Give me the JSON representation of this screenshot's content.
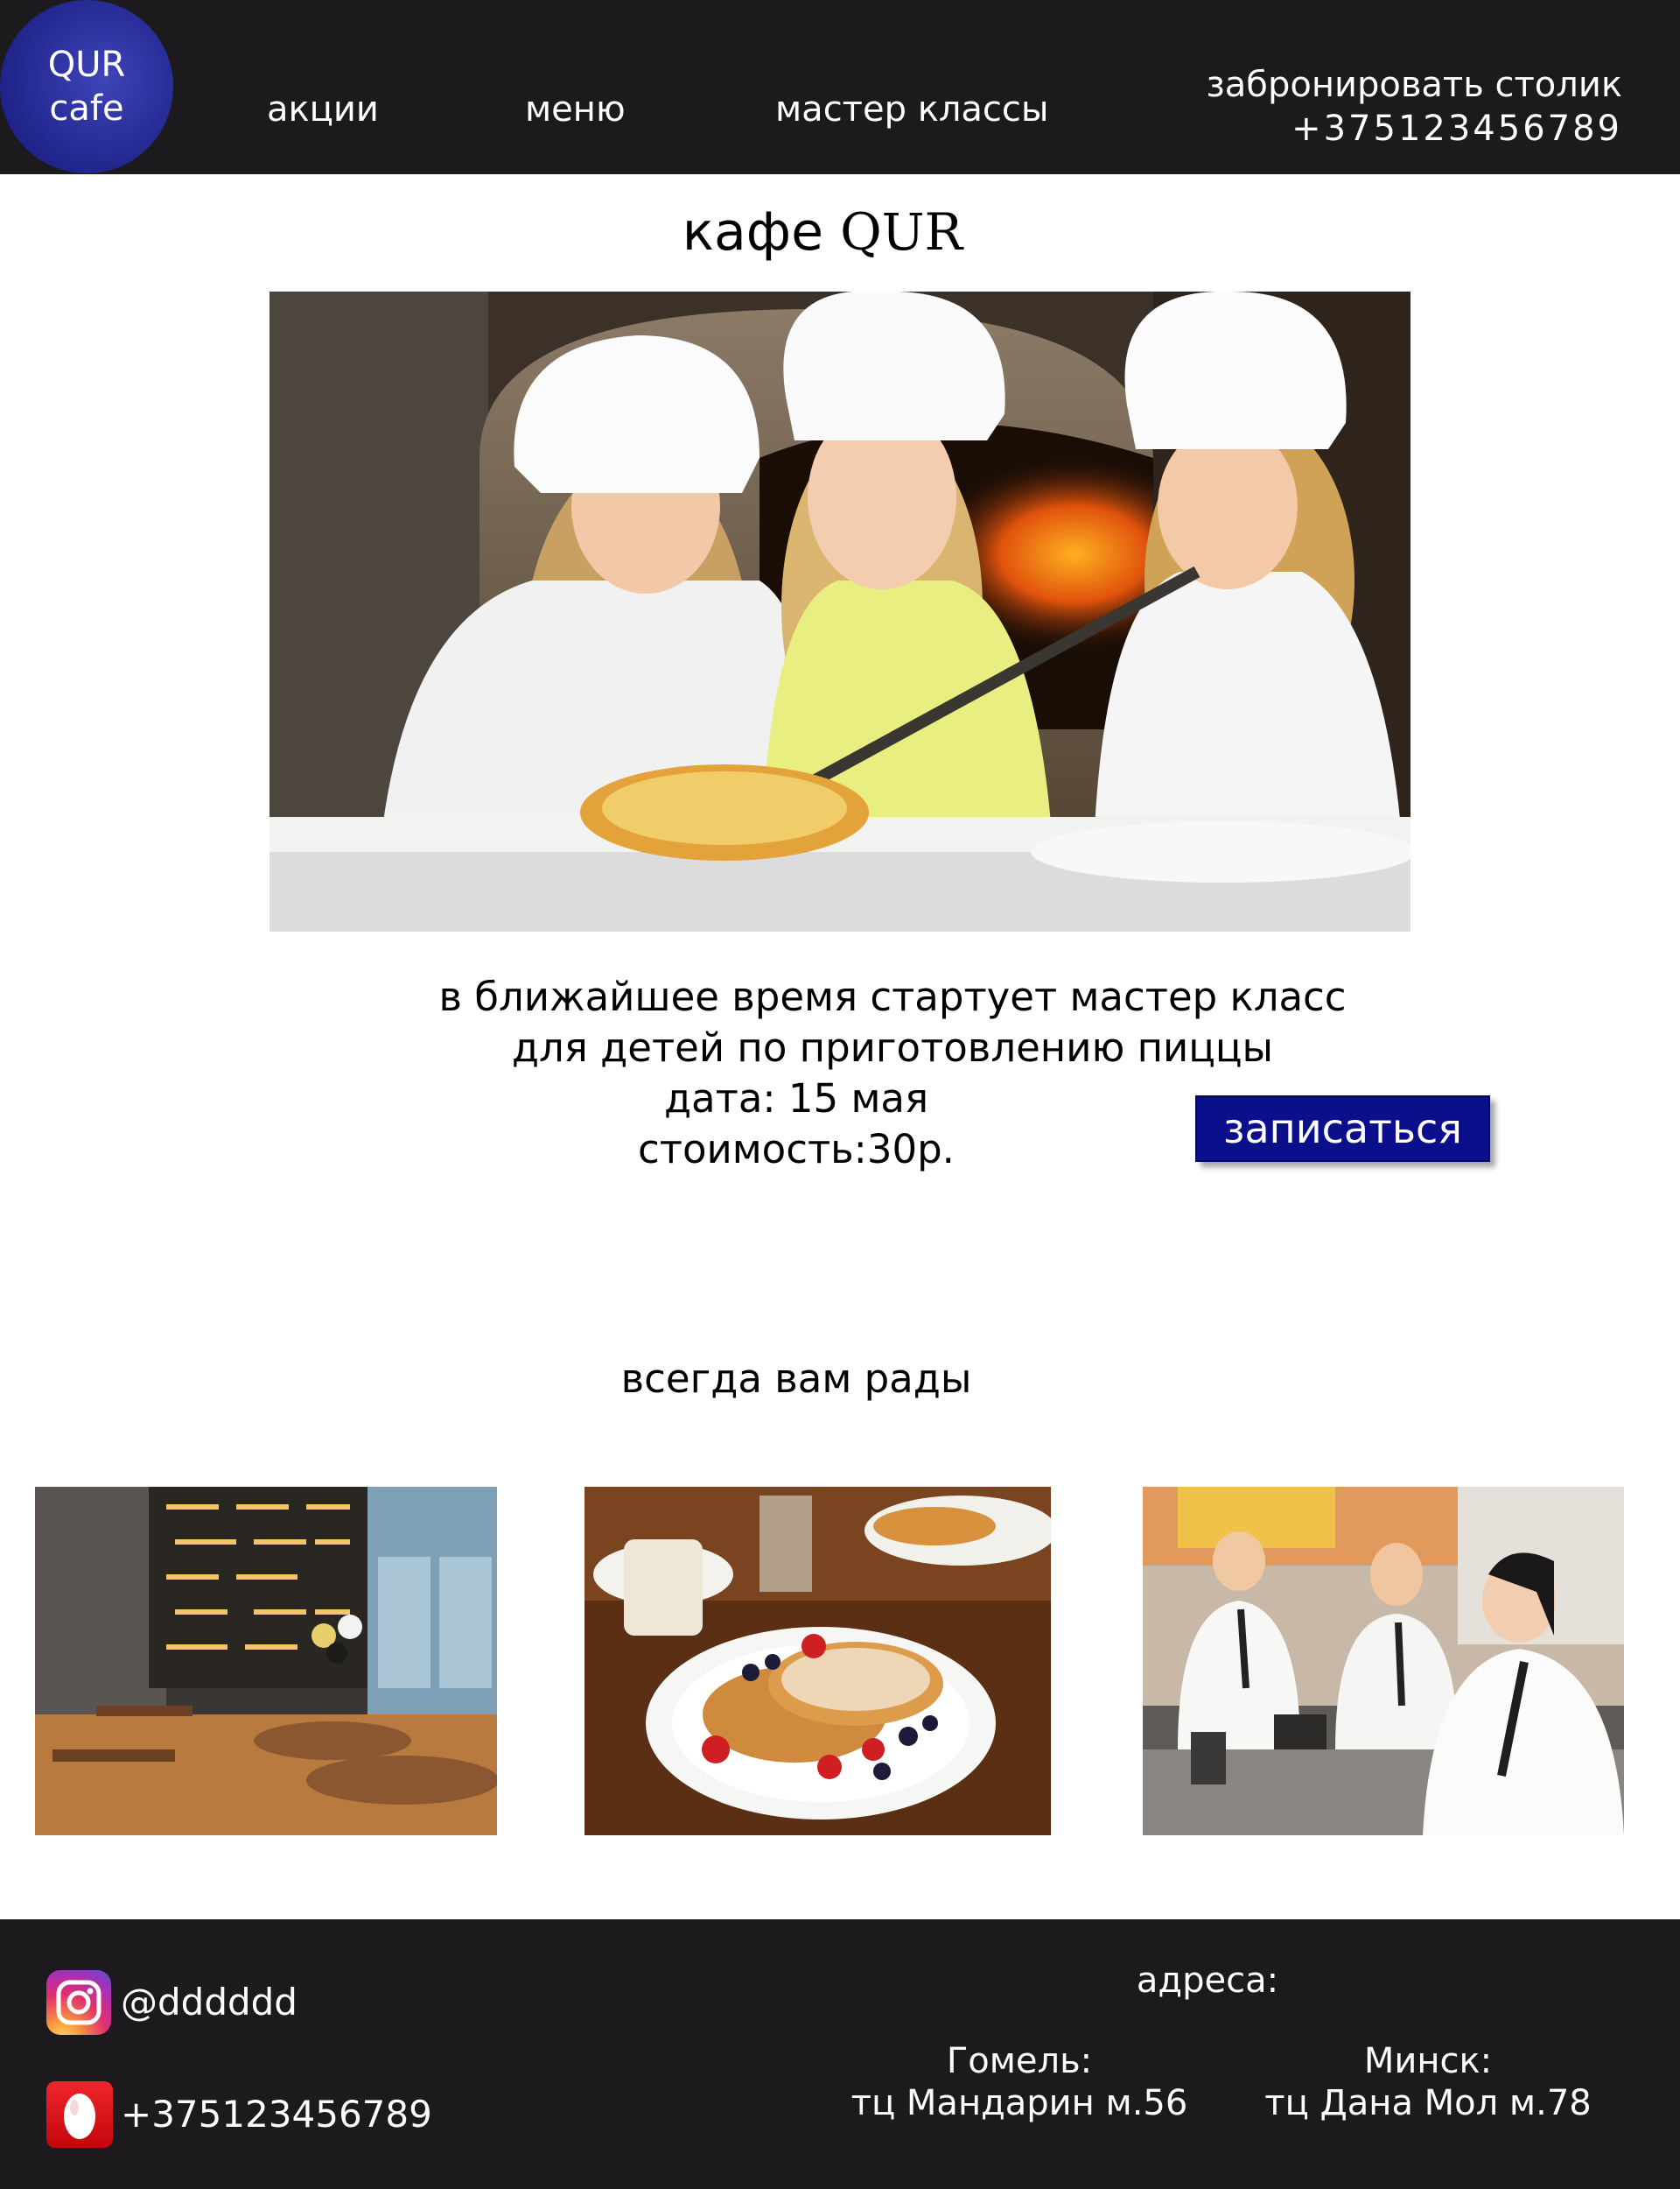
{
  "header": {
    "logo": {
      "line1": "QUR",
      "line2": "cafe"
    },
    "nav": [
      {
        "label": "акции"
      },
      {
        "label": "меню"
      },
      {
        "label": "мастер классы"
      }
    ],
    "booking": {
      "label": "забронировать столик",
      "phone": "+375123456789"
    }
  },
  "main": {
    "title": {
      "word": "кафе",
      "brand": "QUR"
    },
    "announcement": {
      "line1": "в ближайшее время стартует мастер класс",
      "line2": "для детей по приготовлению пиццы",
      "date": "дата: 15 мая",
      "price": "стоимость:30р."
    },
    "signup_label": "записаться",
    "welcome": "всегда вам рады"
  },
  "footer": {
    "instagram": "@dddddd",
    "phone": "+375123456789",
    "addresses_title": "адреса:",
    "addresses": [
      {
        "city": "Гомель:",
        "place": "тц Мандарин м.56"
      },
      {
        "city": "Минск:",
        "place": "тц Дана Мол м.78"
      }
    ]
  },
  "colors": {
    "header_bg": "#1c1a1d",
    "logo_blue": "#2a2f9a",
    "button_blue": "#0c0f8c",
    "text": "#000000"
  },
  "icons": [
    "instagram-icon",
    "phone-app-icon"
  ]
}
